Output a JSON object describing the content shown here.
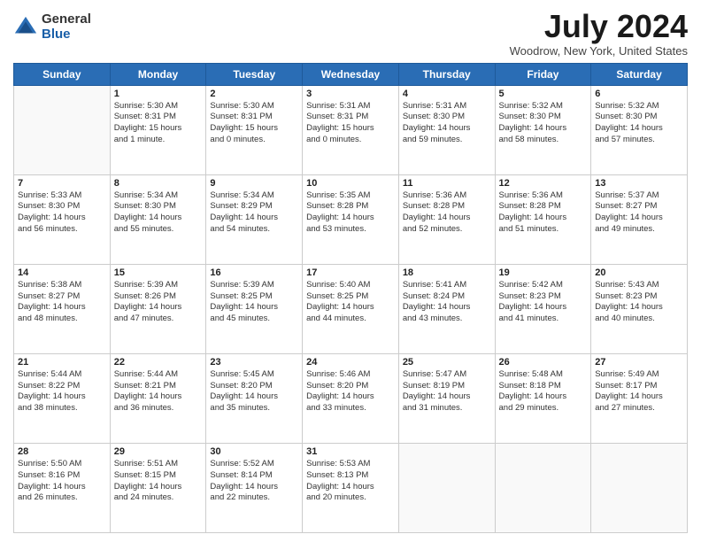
{
  "header": {
    "logo_general": "General",
    "logo_blue": "Blue",
    "month_title": "July 2024",
    "location": "Woodrow, New York, United States"
  },
  "days_of_week": [
    "Sunday",
    "Monday",
    "Tuesday",
    "Wednesday",
    "Thursday",
    "Friday",
    "Saturday"
  ],
  "weeks": [
    [
      {
        "day": "",
        "info": ""
      },
      {
        "day": "1",
        "info": "Sunrise: 5:30 AM\nSunset: 8:31 PM\nDaylight: 15 hours\nand 1 minute."
      },
      {
        "day": "2",
        "info": "Sunrise: 5:30 AM\nSunset: 8:31 PM\nDaylight: 15 hours\nand 0 minutes."
      },
      {
        "day": "3",
        "info": "Sunrise: 5:31 AM\nSunset: 8:31 PM\nDaylight: 15 hours\nand 0 minutes."
      },
      {
        "day": "4",
        "info": "Sunrise: 5:31 AM\nSunset: 8:30 PM\nDaylight: 14 hours\nand 59 minutes."
      },
      {
        "day": "5",
        "info": "Sunrise: 5:32 AM\nSunset: 8:30 PM\nDaylight: 14 hours\nand 58 minutes."
      },
      {
        "day": "6",
        "info": "Sunrise: 5:32 AM\nSunset: 8:30 PM\nDaylight: 14 hours\nand 57 minutes."
      }
    ],
    [
      {
        "day": "7",
        "info": "Sunrise: 5:33 AM\nSunset: 8:30 PM\nDaylight: 14 hours\nand 56 minutes."
      },
      {
        "day": "8",
        "info": "Sunrise: 5:34 AM\nSunset: 8:30 PM\nDaylight: 14 hours\nand 55 minutes."
      },
      {
        "day": "9",
        "info": "Sunrise: 5:34 AM\nSunset: 8:29 PM\nDaylight: 14 hours\nand 54 minutes."
      },
      {
        "day": "10",
        "info": "Sunrise: 5:35 AM\nSunset: 8:28 PM\nDaylight: 14 hours\nand 53 minutes."
      },
      {
        "day": "11",
        "info": "Sunrise: 5:36 AM\nSunset: 8:28 PM\nDaylight: 14 hours\nand 52 minutes."
      },
      {
        "day": "12",
        "info": "Sunrise: 5:36 AM\nSunset: 8:28 PM\nDaylight: 14 hours\nand 51 minutes."
      },
      {
        "day": "13",
        "info": "Sunrise: 5:37 AM\nSunset: 8:27 PM\nDaylight: 14 hours\nand 49 minutes."
      }
    ],
    [
      {
        "day": "14",
        "info": "Sunrise: 5:38 AM\nSunset: 8:27 PM\nDaylight: 14 hours\nand 48 minutes."
      },
      {
        "day": "15",
        "info": "Sunrise: 5:39 AM\nSunset: 8:26 PM\nDaylight: 14 hours\nand 47 minutes."
      },
      {
        "day": "16",
        "info": "Sunrise: 5:39 AM\nSunset: 8:25 PM\nDaylight: 14 hours\nand 45 minutes."
      },
      {
        "day": "17",
        "info": "Sunrise: 5:40 AM\nSunset: 8:25 PM\nDaylight: 14 hours\nand 44 minutes."
      },
      {
        "day": "18",
        "info": "Sunrise: 5:41 AM\nSunset: 8:24 PM\nDaylight: 14 hours\nand 43 minutes."
      },
      {
        "day": "19",
        "info": "Sunrise: 5:42 AM\nSunset: 8:23 PM\nDaylight: 14 hours\nand 41 minutes."
      },
      {
        "day": "20",
        "info": "Sunrise: 5:43 AM\nSunset: 8:23 PM\nDaylight: 14 hours\nand 40 minutes."
      }
    ],
    [
      {
        "day": "21",
        "info": "Sunrise: 5:44 AM\nSunset: 8:22 PM\nDaylight: 14 hours\nand 38 minutes."
      },
      {
        "day": "22",
        "info": "Sunrise: 5:44 AM\nSunset: 8:21 PM\nDaylight: 14 hours\nand 36 minutes."
      },
      {
        "day": "23",
        "info": "Sunrise: 5:45 AM\nSunset: 8:20 PM\nDaylight: 14 hours\nand 35 minutes."
      },
      {
        "day": "24",
        "info": "Sunrise: 5:46 AM\nSunset: 8:20 PM\nDaylight: 14 hours\nand 33 minutes."
      },
      {
        "day": "25",
        "info": "Sunrise: 5:47 AM\nSunset: 8:19 PM\nDaylight: 14 hours\nand 31 minutes."
      },
      {
        "day": "26",
        "info": "Sunrise: 5:48 AM\nSunset: 8:18 PM\nDaylight: 14 hours\nand 29 minutes."
      },
      {
        "day": "27",
        "info": "Sunrise: 5:49 AM\nSunset: 8:17 PM\nDaylight: 14 hours\nand 27 minutes."
      }
    ],
    [
      {
        "day": "28",
        "info": "Sunrise: 5:50 AM\nSunset: 8:16 PM\nDaylight: 14 hours\nand 26 minutes."
      },
      {
        "day": "29",
        "info": "Sunrise: 5:51 AM\nSunset: 8:15 PM\nDaylight: 14 hours\nand 24 minutes."
      },
      {
        "day": "30",
        "info": "Sunrise: 5:52 AM\nSunset: 8:14 PM\nDaylight: 14 hours\nand 22 minutes."
      },
      {
        "day": "31",
        "info": "Sunrise: 5:53 AM\nSunset: 8:13 PM\nDaylight: 14 hours\nand 20 minutes."
      },
      {
        "day": "",
        "info": ""
      },
      {
        "day": "",
        "info": ""
      },
      {
        "day": "",
        "info": ""
      }
    ]
  ]
}
